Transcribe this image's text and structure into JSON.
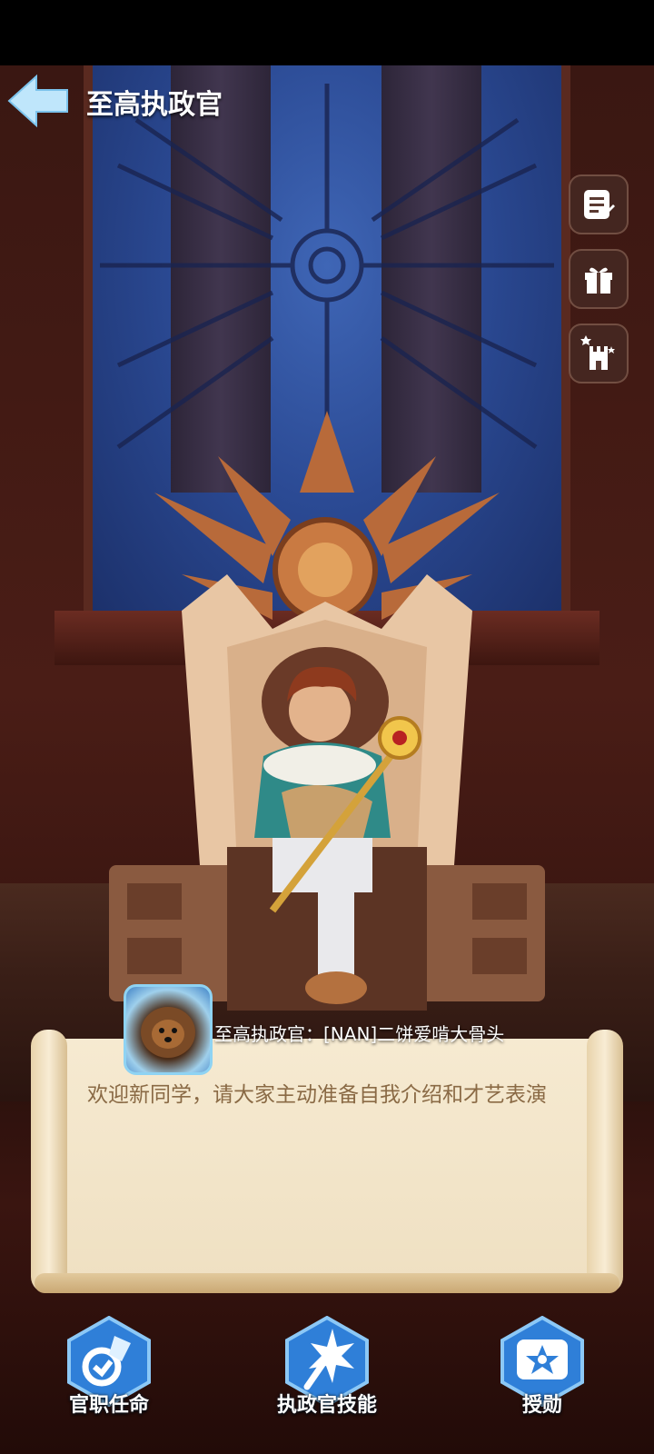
{
  "header": {
    "title": "至高执政官"
  },
  "side_buttons": [
    {
      "icon": "notes-icon"
    },
    {
      "icon": "gift-icon"
    },
    {
      "icon": "castle-icon"
    }
  ],
  "announcement": {
    "speaker": "至高执政官：[NAN]二饼爱啃大骨头",
    "message": "欢迎新同学，请大家主动准备自我介绍和才艺表演"
  },
  "bottom_nav": [
    {
      "label": "官职任命",
      "icon": "appoint-icon"
    },
    {
      "label": "执政官技能",
      "icon": "skill-icon"
    },
    {
      "label": "授勋",
      "icon": "medal-icon"
    }
  ],
  "colors": {
    "accent_blue": "#2f7fd8",
    "scroll_text": "#8a6a45"
  }
}
